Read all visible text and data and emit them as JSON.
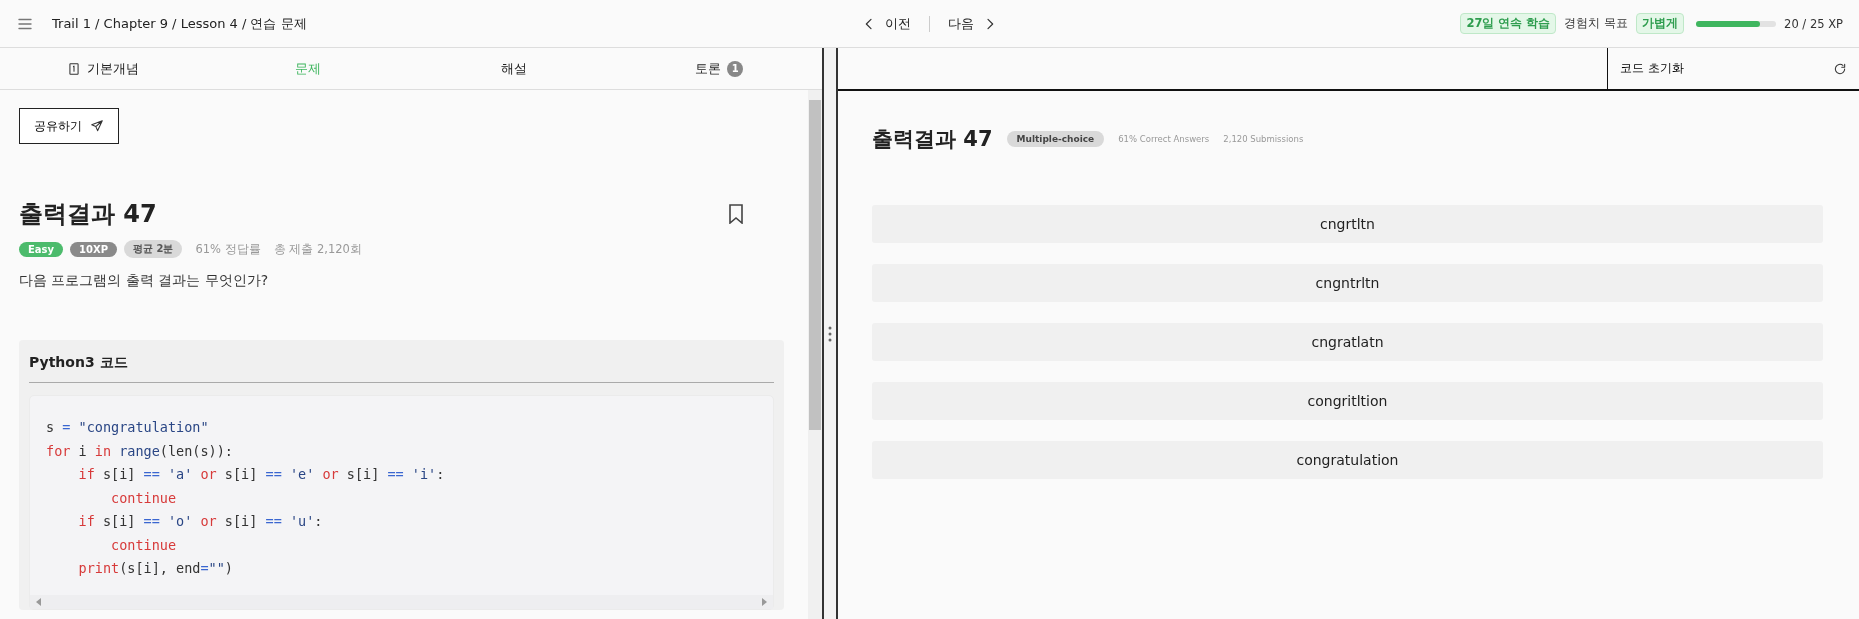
{
  "breadcrumb": "Trail 1 / Chapter 9 / Lesson 4 / 연습 문제",
  "nav": {
    "prev": "이전",
    "next": "다음"
  },
  "status": {
    "streak": "27일 연속 학습",
    "goal_label": "경험치 목표",
    "goal": "가볍게",
    "level": 0.8,
    "xp": "20 / 25 XP"
  },
  "tabs": [
    {
      "label": "기본개념",
      "selected": false,
      "kind": "icon"
    },
    {
      "label": "문제",
      "selected": true,
      "kind": "plain"
    },
    {
      "label": "해설",
      "selected": false,
      "kind": "plain"
    },
    {
      "label": "토론",
      "selected": false,
      "kind": "count",
      "count": "1"
    }
  ],
  "share_button": "공유하기",
  "problem": {
    "title": "출력결과 47",
    "bookmarked": false,
    "badges": [
      {
        "text": "Easy",
        "color": "#4cbb6c"
      },
      {
        "text": "10XP",
        "color": "#8a8a8a"
      },
      {
        "text": "평균 2분",
        "color": "#d9d9d9"
      }
    ],
    "stats": [
      "61% 정답률",
      "총 제출 2,120회"
    ],
    "question": "다음 프로그램의 출력 결과는 무엇인가?"
  },
  "code": {
    "title": "Python3 코드",
    "lines": [
      [
        {
          "text": "s ",
          "kind": "plain"
        },
        {
          "text": "=",
          "kind": "op"
        },
        {
          "text": " \"congratulation\"",
          "kind": "string"
        }
      ],
      [
        {
          "text": "for",
          "kind": "keyword"
        },
        {
          "text": " i ",
          "kind": "plain"
        },
        {
          "text": "in",
          "kind": "keyword"
        },
        {
          "text": " range",
          "kind": "string"
        },
        {
          "text": "(len(s)):",
          "kind": "plain"
        }
      ],
      [
        {
          "text": "    if",
          "kind": "keyword"
        },
        {
          "text": " s[i] ",
          "kind": "plain"
        },
        {
          "text": "==",
          "kind": "op"
        },
        {
          "text": " 'a' ",
          "kind": "string"
        },
        {
          "text": "or",
          "kind": "keyword"
        },
        {
          "text": " s[i] ",
          "kind": "plain"
        },
        {
          "text": "==",
          "kind": "op"
        },
        {
          "text": " 'e' ",
          "kind": "string"
        },
        {
          "text": "or",
          "kind": "keyword"
        },
        {
          "text": " s[i] ",
          "kind": "plain"
        },
        {
          "text": "==",
          "kind": "op"
        },
        {
          "text": " 'i'",
          "kind": "string"
        },
        {
          "text": ":",
          "kind": "plain"
        }
      ],
      [
        {
          "text": "        continue",
          "kind": "keyword"
        }
      ],
      [
        {
          "text": "    if",
          "kind": "keyword"
        },
        {
          "text": " s[i] ",
          "kind": "plain"
        },
        {
          "text": "==",
          "kind": "op"
        },
        {
          "text": " 'o' ",
          "kind": "string"
        },
        {
          "text": "or",
          "kind": "keyword"
        },
        {
          "text": " s[i] ",
          "kind": "plain"
        },
        {
          "text": "==",
          "kind": "op"
        },
        {
          "text": " 'u'",
          "kind": "string"
        },
        {
          "text": ":",
          "kind": "plain"
        }
      ],
      [
        {
          "text": "        continue",
          "kind": "keyword"
        }
      ],
      [
        {
          "text": "    print",
          "kind": "keyword"
        },
        {
          "text": "(s[i], end",
          "kind": "plain"
        },
        {
          "text": "=",
          "kind": "op"
        },
        {
          "text": "\"\"",
          "kind": "string"
        },
        {
          "text": ")",
          "kind": "plain"
        }
      ]
    ]
  },
  "right": {
    "reset_button": "코드 초기화",
    "title": "출력결과 47",
    "type_badge": "Multiple-choice",
    "stats": [
      "61% Correct Answers",
      "2,120 Submissions"
    ],
    "options": [
      {
        "text": "cngrtltn",
        "selected": false
      },
      {
        "text": "cngntrltn",
        "selected": false
      },
      {
        "text": "cngratlatn",
        "selected": false
      },
      {
        "text": "congritltion",
        "selected": false
      },
      {
        "text": "congratulation",
        "selected": false
      }
    ]
  }
}
